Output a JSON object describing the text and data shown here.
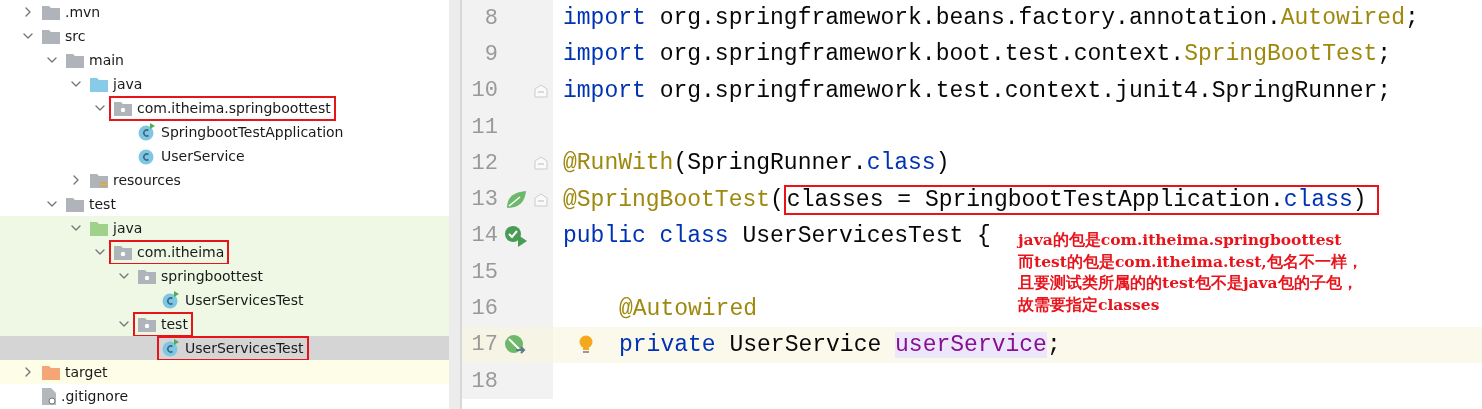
{
  "project_tree": [
    {
      "label": ".mvn",
      "kind": "folder",
      "expanded": false,
      "boxed": false,
      "selected": false,
      "test_scope": false
    },
    {
      "label": "src",
      "kind": "folder",
      "expanded": true,
      "boxed": false,
      "selected": false,
      "test_scope": false,
      "children": [
        {
          "label": "main",
          "kind": "folder",
          "expanded": true,
          "boxed": false,
          "selected": false,
          "test_scope": false,
          "children": [
            {
              "label": "java",
              "kind": "source-root",
              "expanded": true,
              "boxed": false,
              "selected": false,
              "test_scope": false,
              "children": [
                {
                  "label": "com.itheima.springboottest",
                  "kind": "package",
                  "expanded": true,
                  "boxed": true,
                  "selected": false,
                  "test_scope": false,
                  "children": [
                    {
                      "label": "SpringbootTestApplication",
                      "kind": "app-class",
                      "boxed": false,
                      "selected": false,
                      "test_scope": false
                    },
                    {
                      "label": "UserService",
                      "kind": "class",
                      "boxed": false,
                      "selected": false,
                      "test_scope": false
                    }
                  ]
                }
              ]
            },
            {
              "label": "resources",
              "kind": "resources",
              "expanded": false,
              "boxed": false,
              "selected": false,
              "test_scope": false
            }
          ]
        },
        {
          "label": "test",
          "kind": "folder",
          "expanded": true,
          "boxed": false,
          "selected": false,
          "test_scope": false,
          "children": [
            {
              "label": "java",
              "kind": "test-root",
              "expanded": true,
              "boxed": false,
              "selected": false,
              "test_scope": true,
              "children": [
                {
                  "label": "com.itheima",
                  "kind": "package",
                  "expanded": true,
                  "boxed": true,
                  "selected": false,
                  "test_scope": true,
                  "children": [
                    {
                      "label": "springboottest",
                      "kind": "package",
                      "expanded": true,
                      "boxed": false,
                      "selected": false,
                      "test_scope": true,
                      "children": [
                        {
                          "label": "UserServicesTest",
                          "kind": "test-class",
                          "boxed": false,
                          "selected": false,
                          "test_scope": true
                        }
                      ]
                    },
                    {
                      "label": "test",
                      "kind": "package",
                      "expanded": true,
                      "boxed": true,
                      "selected": false,
                      "test_scope": true,
                      "children": [
                        {
                          "label": "UserServicesTest",
                          "kind": "test-class",
                          "boxed": true,
                          "selected": true,
                          "test_scope": true
                        }
                      ]
                    }
                  ]
                }
              ]
            }
          ]
        }
      ]
    },
    {
      "label": "target",
      "kind": "excluded",
      "expanded": false,
      "boxed": false,
      "selected": false,
      "test_scope": false
    },
    {
      "label": ".gitignore",
      "kind": "file",
      "boxed": false,
      "selected": false,
      "test_scope": false
    }
  ],
  "editor": {
    "lines": [
      {
        "number": "8",
        "fold": false,
        "current": false,
        "indented": false,
        "tokens": [
          {
            "kind": "keyword",
            "text": "import"
          },
          {
            "kind": "plain",
            "text": " org.springframework.beans.factory.annotation."
          },
          {
            "kind": "annotation",
            "text": "Autowired"
          },
          {
            "kind": "plain",
            "text": ";"
          }
        ]
      },
      {
        "number": "9",
        "fold": false,
        "current": false,
        "indented": false,
        "tokens": [
          {
            "kind": "keyword",
            "text": "import"
          },
          {
            "kind": "plain",
            "text": " org.springframework.boot.test.context."
          },
          {
            "kind": "annotation",
            "text": "SpringBootTest"
          },
          {
            "kind": "plain",
            "text": ";"
          }
        ]
      },
      {
        "number": "10",
        "fold": true,
        "current": false,
        "indented": false,
        "tokens": [
          {
            "kind": "keyword",
            "text": "import"
          },
          {
            "kind": "plain",
            "text": " org.springframework.test.context.junit4.SpringRunner;"
          }
        ]
      },
      {
        "number": "11",
        "fold": false,
        "current": false,
        "indented": false
      },
      {
        "number": "12",
        "fold": true,
        "current": false,
        "indented": false,
        "tokens": [
          {
            "kind": "annotation",
            "text": "@RunWith"
          },
          {
            "kind": "plain",
            "text": "(SpringRunner."
          },
          {
            "kind": "keyword",
            "text": "class"
          },
          {
            "kind": "plain",
            "text": ")"
          }
        ]
      },
      {
        "number": "13",
        "marker": {
          "kind": "spring"
        },
        "fold": true,
        "current": false,
        "indented": false,
        "tokens": [
          {
            "kind": "annotation",
            "text": "@SpringBootTest"
          },
          {
            "kind": "plain",
            "text": "("
          },
          {
            "kind": "plain",
            "text": "classes = SpringbootTestApplication.",
            "boxed": true
          },
          {
            "kind": "keyword",
            "text": "class",
            "boxed": true
          },
          {
            "kind": "plain",
            "text": ")",
            "boxed": true
          }
        ]
      },
      {
        "number": "14",
        "marker": {
          "kind": "run"
        },
        "fold": false,
        "current": false,
        "indented": false,
        "tokens": [
          {
            "kind": "keyword",
            "text": "public class"
          },
          {
            "kind": "plain",
            "text": " UserServicesTest {"
          }
        ]
      },
      {
        "number": "15",
        "fold": false,
        "current": false,
        "indented": false
      },
      {
        "number": "16",
        "fold": false,
        "current": false,
        "indented": true,
        "tokens": [
          {
            "kind": "annotation",
            "text": "@Autowired"
          }
        ]
      },
      {
        "number": "17",
        "marker": {
          "kind": "inject"
        },
        "fold": false,
        "current": true,
        "bulb": true,
        "indented": true,
        "tokens": [
          {
            "kind": "keyword",
            "text": "private"
          },
          {
            "kind": "plain",
            "text": " UserService "
          },
          {
            "kind": "field",
            "text": "userService"
          },
          {
            "kind": "plain",
            "text": ";"
          }
        ]
      },
      {
        "number": "18",
        "fold": false,
        "current": false,
        "indented": false
      }
    ],
    "note": [
      "java的包是com.itheima.springboottest",
      "而test的包是com.itheima.test,包名不一样，",
      "且要测试类所属的的test包不是java包的子包，",
      "故需要指定classes"
    ]
  }
}
